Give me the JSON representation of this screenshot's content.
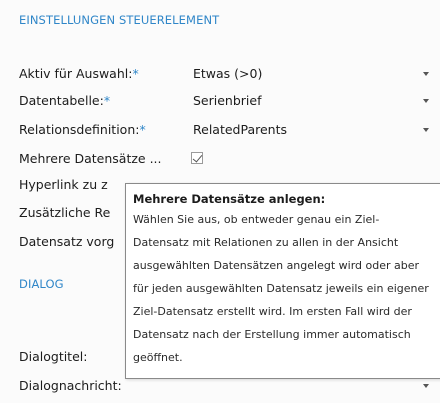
{
  "header": {
    "title": "EINSTELLUNGEN STEUERELEMENT"
  },
  "fields": [
    {
      "label": "Aktiv für Auswahl:",
      "required": "*",
      "value": "Etwas (>0)"
    },
    {
      "label": "Datentabelle:",
      "required": "*",
      "value": "Serienbrief"
    },
    {
      "label": "Relationsdefinition:",
      "required": "*",
      "value": "RelatedParents"
    }
  ],
  "checkbox_field": {
    "label": "Mehrere Datensätze ...",
    "checked": true
  },
  "truncated_rows": [
    "Hyperlink zu z",
    "Zusätzliche Re",
    "Datensatz vorg"
  ],
  "dialog": {
    "title": "DIALOG",
    "fields": [
      {
        "label": "Dialogtitel:"
      },
      {
        "label": "Dialognachricht:"
      }
    ]
  },
  "tooltip": {
    "title": "Mehrere Datensätze anlegen:",
    "lines": [
      "Wählen Sie aus, ob entweder genau ein Ziel-",
      "Datensatz mit Relationen zu allen in der Ansicht",
      "ausgewählten Datensätzen angelegt wird oder aber",
      "für jeden ausgewählten Datensatz jeweils ein eigener",
      "Ziel-Datensatz erstellt wird. Im ersten Fall wird der",
      "Datensatz nach der Erstellung immer automatisch",
      "geöffnet."
    ]
  },
  "icons": {
    "dropdown": "chevron-down-icon",
    "check": "checkmark-icon"
  },
  "colors": {
    "accent": "#2f86c8",
    "text": "#1c1c1c"
  }
}
